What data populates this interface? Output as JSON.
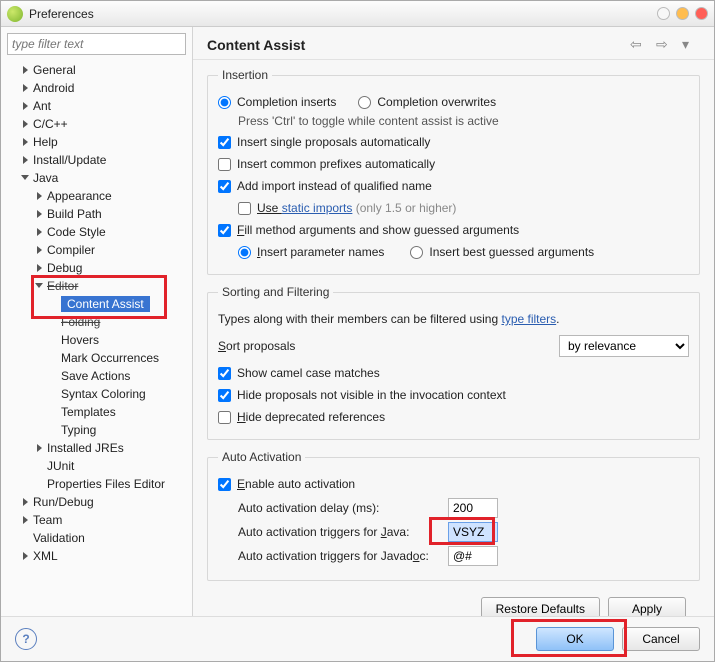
{
  "title": "Preferences",
  "filter_placeholder": "type filter text",
  "tree": {
    "general": "General",
    "android": "Android",
    "ant": "Ant",
    "cpp": "C/C++",
    "help": "Help",
    "install": "Install/Update",
    "java": "Java",
    "appearance": "Appearance",
    "buildpath": "Build Path",
    "codestyle": "Code Style",
    "compiler": "Compiler",
    "debug": "Debug",
    "editor": "Editor",
    "contentassist": "Content Assist",
    "folding": "Folding",
    "hovers": "Hovers",
    "markocc": "Mark Occurrences",
    "saveactions": "Save Actions",
    "syntax": "Syntax Coloring",
    "templates": "Templates",
    "typing": "Typing",
    "installedjres": "Installed JREs",
    "junit": "JUnit",
    "propfileeditor": "Properties Files Editor",
    "rundebug": "Run/Debug",
    "team": "Team",
    "validation": "Validation",
    "xml": "XML"
  },
  "content": {
    "heading": "Content Assist",
    "sections": {
      "insertion": {
        "legend": "Insertion",
        "completion_inserts": "Completion inserts",
        "completion_overwrites": "Completion overwrites",
        "ctrl_hint": "Press 'Ctrl' to toggle while content assist is active",
        "insert_single": "Insert single proposals automatically",
        "insert_prefixes": "Insert common prefixes automatically",
        "add_import": "Add import instead of qualified name",
        "use_static_pre": "Use ",
        "use_static_link": "static imports",
        "use_static_post": " (only 1.5 or higher)",
        "fill_method": "Fill method arguments and show guessed arguments",
        "insert_param_names": "Insert parameter names",
        "insert_best_guessed": "Insert best guessed arguments"
      },
      "sorting": {
        "legend": "Sorting and Filtering",
        "typefilters_pre": "Types along with their members can be filtered using ",
        "typefilters_link": "type filters",
        "sort_proposals": "Sort proposals",
        "sort_value": "by relevance",
        "show_camel": "Show camel case matches",
        "hide_not_visible": "Hide proposals not visible in the invocation context",
        "hide_deprecated": "Hide deprecated references"
      },
      "autoact": {
        "legend": "Auto Activation",
        "enable": "Enable auto activation",
        "delay_label": "Auto activation delay (ms):",
        "delay_value": "200",
        "triggers_java_label": "Auto activation triggers for Java:",
        "triggers_java_value": "VSYZ",
        "triggers_javadoc_label": "Auto activation triggers for Javadoc:",
        "triggers_javadoc_value": "@#"
      }
    },
    "buttons": {
      "restore": "Restore Defaults",
      "apply": "Apply",
      "ok": "OK",
      "cancel": "Cancel"
    }
  }
}
